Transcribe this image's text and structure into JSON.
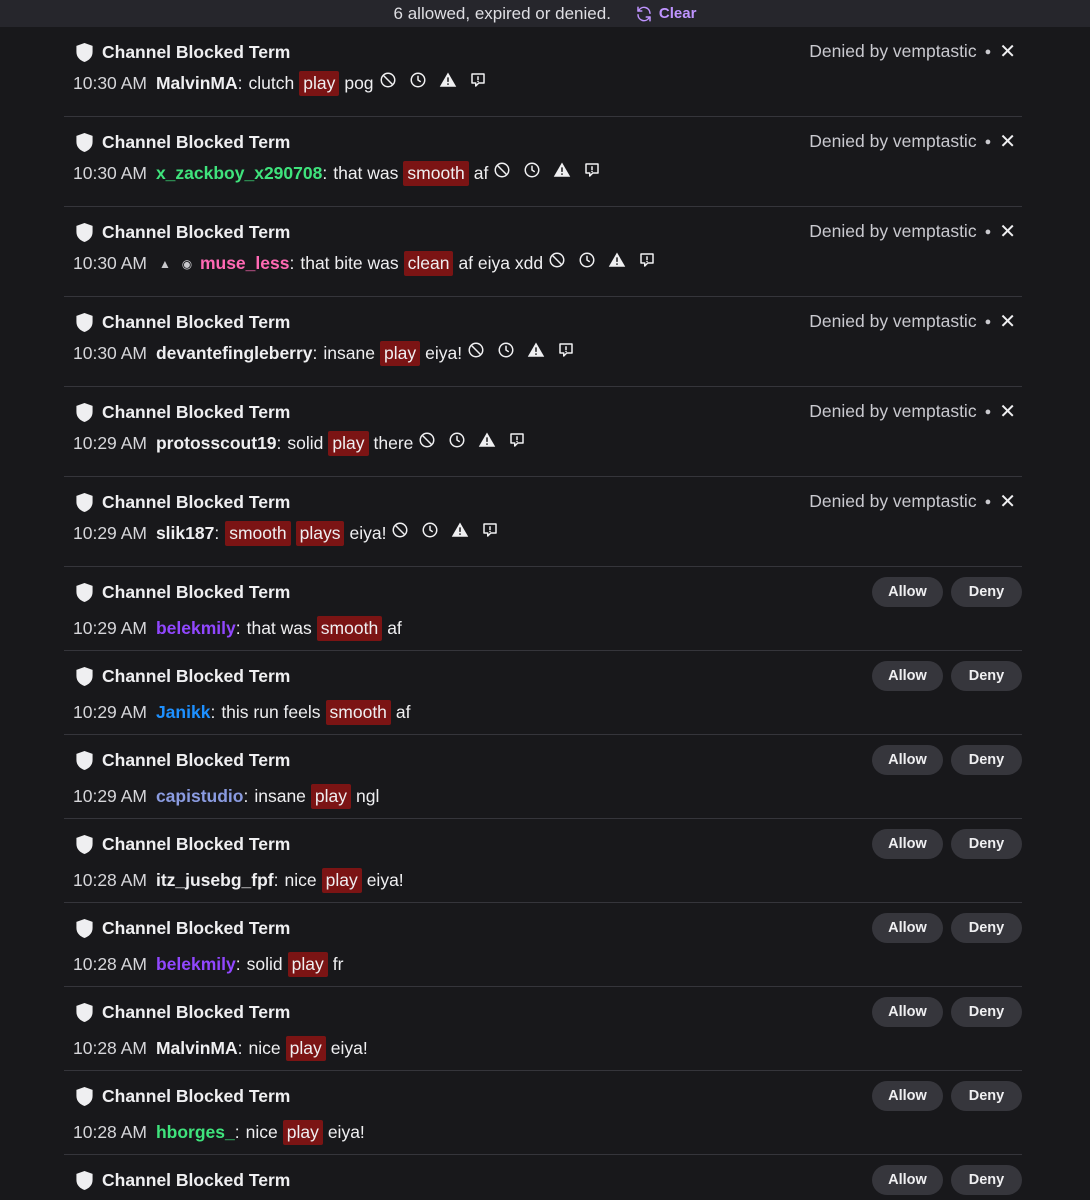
{
  "topbar": {
    "summary": "6 allowed, expired or denied.",
    "clear_label": "Clear"
  },
  "labels": {
    "event_title": "Channel Blocked Term",
    "allow": "Allow",
    "deny": "Deny"
  },
  "colors": {
    "accent": "#bf94ff",
    "term_bg": "#7b1414"
  },
  "items": [
    {
      "time": "10:30 AM",
      "user": "MalvinMA",
      "color": "#efeff1",
      "status": "Denied by vemptastic",
      "parts": [
        {
          "t": "w",
          "v": "clutch"
        },
        {
          "t": "term",
          "v": "play"
        },
        {
          "t": "w",
          "v": "pog"
        }
      ]
    },
    {
      "time": "10:30 AM",
      "user": "x_zackboy_x290708",
      "color": "#3fe37c",
      "status": "Denied by vemptastic",
      "parts": [
        {
          "t": "w",
          "v": "that was"
        },
        {
          "t": "term",
          "v": "smooth"
        },
        {
          "t": "w",
          "v": "af"
        }
      ]
    },
    {
      "time": "10:30 AM",
      "user": "muse_less",
      "color": "#ff69b4",
      "status": "Denied by vemptastic",
      "badges": true,
      "parts": [
        {
          "t": "w",
          "v": "that bite was"
        },
        {
          "t": "term",
          "v": "clean"
        },
        {
          "t": "w",
          "v": "af eiya xdd"
        }
      ]
    },
    {
      "time": "10:30 AM",
      "user": "devantefingleberry",
      "color": "#efeff1",
      "status": "Denied by vemptastic",
      "parts": [
        {
          "t": "w",
          "v": "insane"
        },
        {
          "t": "term",
          "v": "play"
        },
        {
          "t": "w",
          "v": "eiya!"
        }
      ]
    },
    {
      "time": "10:29 AM",
      "user": "protosscout19",
      "color": "#efeff1",
      "status": "Denied by vemptastic",
      "parts": [
        {
          "t": "w",
          "v": "solid"
        },
        {
          "t": "term",
          "v": "play"
        },
        {
          "t": "w",
          "v": "there"
        }
      ]
    },
    {
      "time": "10:29 AM",
      "user": "slik187",
      "color": "#efeff1",
      "status": "Denied by vemptastic",
      "parts": [
        {
          "t": "term",
          "v": "smooth"
        },
        {
          "t": "term",
          "v": "plays"
        },
        {
          "t": "w",
          "v": "eiya!"
        }
      ]
    },
    {
      "time": "10:29 AM",
      "user": "belekmily",
      "color": "#9147ff",
      "parts": [
        {
          "t": "w",
          "v": "that was"
        },
        {
          "t": "term",
          "v": "smooth"
        },
        {
          "t": "w",
          "v": "af"
        }
      ]
    },
    {
      "time": "10:29 AM",
      "user": "Janikk",
      "color": "#1e90ff",
      "parts": [
        {
          "t": "w",
          "v": "this run feels"
        },
        {
          "t": "term",
          "v": "smooth"
        },
        {
          "t": "w",
          "v": "af"
        }
      ]
    },
    {
      "time": "10:29 AM",
      "user": "capistudio",
      "color": "#8a9be0",
      "parts": [
        {
          "t": "w",
          "v": "insane"
        },
        {
          "t": "term",
          "v": "play"
        },
        {
          "t": "w",
          "v": "ngl"
        }
      ]
    },
    {
      "time": "10:28 AM",
      "user": "itz_jusebg_fpf",
      "color": "#efeff1",
      "parts": [
        {
          "t": "w",
          "v": "nice"
        },
        {
          "t": "term",
          "v": "play"
        },
        {
          "t": "w",
          "v": "eiya!"
        }
      ]
    },
    {
      "time": "10:28 AM",
      "user": "belekmily",
      "color": "#9147ff",
      "parts": [
        {
          "t": "w",
          "v": "solid"
        },
        {
          "t": "term",
          "v": "play"
        },
        {
          "t": "w",
          "v": "fr"
        }
      ]
    },
    {
      "time": "10:28 AM",
      "user": "MalvinMA",
      "color": "#efeff1",
      "parts": [
        {
          "t": "w",
          "v": "nice"
        },
        {
          "t": "term",
          "v": "play"
        },
        {
          "t": "w",
          "v": "eiya!"
        }
      ]
    },
    {
      "time": "10:28 AM",
      "user": "hborges_",
      "color": "#3fe37c",
      "parts": [
        {
          "t": "w",
          "v": "nice"
        },
        {
          "t": "term",
          "v": "play"
        },
        {
          "t": "w",
          "v": "eiya!"
        }
      ]
    },
    {
      "time": "",
      "user": "",
      "color": "#efeff1",
      "parts": []
    }
  ]
}
